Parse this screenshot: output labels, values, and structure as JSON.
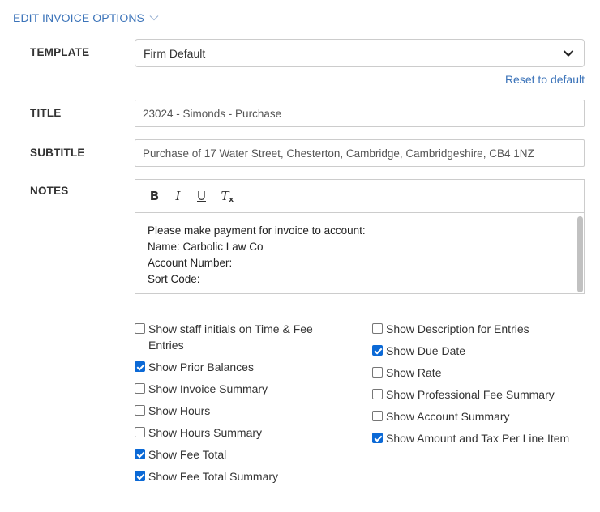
{
  "section": {
    "title": "EDIT INVOICE OPTIONS"
  },
  "template": {
    "label": "TEMPLATE",
    "selected": "Firm Default",
    "reset_link": "Reset to default"
  },
  "title": {
    "label": "TITLE",
    "value": "23024 - Simonds - Purchase"
  },
  "subtitle": {
    "label": "SUBTITLE",
    "value": "Purchase of 17 Water Street, Chesterton, Cambridge, Cambridgeshire, CB4 1NZ"
  },
  "notes": {
    "label": "NOTES",
    "toolbar": {
      "bold": "B",
      "italic": "I",
      "underline": "U",
      "clear": "T",
      "clear_x": "x"
    },
    "lines": [
      "Please make payment for invoice to account:",
      "Name: Carbolic Law Co",
      "Account Number:",
      "Sort Code:"
    ]
  },
  "options_left": [
    {
      "label": "Show staff initials on Time & Fee Entries",
      "checked": false
    },
    {
      "label": "Show Prior Balances",
      "checked": true
    },
    {
      "label": "Show Invoice Summary",
      "checked": false
    },
    {
      "label": "Show Hours",
      "checked": false
    },
    {
      "label": "Show Hours Summary",
      "checked": false
    },
    {
      "label": "Show Fee Total",
      "checked": true
    },
    {
      "label": "Show Fee Total Summary",
      "checked": true
    }
  ],
  "options_right": [
    {
      "label": "Show Description for Entries",
      "checked": false
    },
    {
      "label": "Show Due Date",
      "checked": true
    },
    {
      "label": "Show Rate",
      "checked": false
    },
    {
      "label": "Show Professional Fee Summary",
      "checked": false
    },
    {
      "label": "Show Account Summary",
      "checked": false
    },
    {
      "label": "Show Amount and Tax Per Line Item",
      "checked": true
    }
  ],
  "colors": {
    "link": "#3b73b9",
    "checkbox_checked": "#0b69d6",
    "border": "#cccccc"
  },
  "icons": {
    "section_toggle": "chevron-down-icon",
    "select_caret": "caret-down-icon"
  }
}
